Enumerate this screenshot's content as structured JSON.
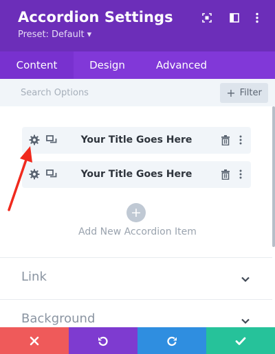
{
  "header": {
    "title": "Accordion Settings",
    "preset": "Preset: Default ▾",
    "bg_color": "#6c2eb9",
    "icons": [
      "focus-icon",
      "sidebar-toggle-icon",
      "more-vertical-icon"
    ]
  },
  "tabs": [
    {
      "label": "Content",
      "active": true
    },
    {
      "label": "Design",
      "active": false
    },
    {
      "label": "Advanced",
      "active": false
    }
  ],
  "search": {
    "placeholder": "Search Options",
    "filter_label": "Filter"
  },
  "accordion_items": [
    {
      "title": "Your Title Goes Here"
    },
    {
      "title": "Your Title Goes Here"
    }
  ],
  "add_item_label": "Add New Accordion Item",
  "sections": [
    {
      "name": "Link"
    },
    {
      "name": "Background"
    }
  ],
  "footer": {
    "buttons": [
      {
        "name": "discard",
        "icon": "close-icon",
        "color": "#ef5a5a"
      },
      {
        "name": "undo",
        "icon": "undo-icon",
        "color": "#7e3bd0"
      },
      {
        "name": "redo",
        "icon": "redo-icon",
        "color": "#2f8ee0"
      },
      {
        "name": "save",
        "icon": "check-icon",
        "color": "#26c29a"
      }
    ]
  },
  "annotation": {
    "color": "#f02a1e"
  }
}
